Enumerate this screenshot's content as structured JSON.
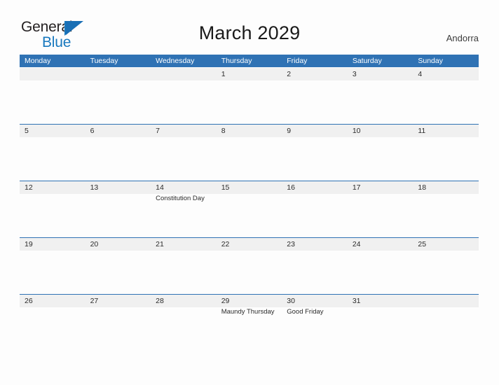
{
  "brand": {
    "name_part1": "General",
    "name_part2": "Blue",
    "flag_icon": "blue-triangle-flag",
    "accent_color": "#1878be"
  },
  "header": {
    "title": "March 2029",
    "country": "Andorra"
  },
  "calendar": {
    "header_color": "#2f72b4",
    "band_color": "#f0f0f0",
    "weekdays": [
      "Monday",
      "Tuesday",
      "Wednesday",
      "Thursday",
      "Friday",
      "Saturday",
      "Sunday"
    ],
    "weeks": [
      {
        "days": [
          {
            "number": "",
            "events": []
          },
          {
            "number": "",
            "events": []
          },
          {
            "number": "",
            "events": []
          },
          {
            "number": "1",
            "events": []
          },
          {
            "number": "2",
            "events": []
          },
          {
            "number": "3",
            "events": []
          },
          {
            "number": "4",
            "events": []
          }
        ]
      },
      {
        "days": [
          {
            "number": "5",
            "events": []
          },
          {
            "number": "6",
            "events": []
          },
          {
            "number": "7",
            "events": []
          },
          {
            "number": "8",
            "events": []
          },
          {
            "number": "9",
            "events": []
          },
          {
            "number": "10",
            "events": []
          },
          {
            "number": "11",
            "events": []
          }
        ]
      },
      {
        "days": [
          {
            "number": "12",
            "events": []
          },
          {
            "number": "13",
            "events": []
          },
          {
            "number": "14",
            "events": [
              "Constitution Day"
            ]
          },
          {
            "number": "15",
            "events": []
          },
          {
            "number": "16",
            "events": []
          },
          {
            "number": "17",
            "events": []
          },
          {
            "number": "18",
            "events": []
          }
        ]
      },
      {
        "days": [
          {
            "number": "19",
            "events": []
          },
          {
            "number": "20",
            "events": []
          },
          {
            "number": "21",
            "events": []
          },
          {
            "number": "22",
            "events": []
          },
          {
            "number": "23",
            "events": []
          },
          {
            "number": "24",
            "events": []
          },
          {
            "number": "25",
            "events": []
          }
        ]
      },
      {
        "days": [
          {
            "number": "26",
            "events": []
          },
          {
            "number": "27",
            "events": []
          },
          {
            "number": "28",
            "events": []
          },
          {
            "number": "29",
            "events": [
              "Maundy Thursday"
            ]
          },
          {
            "number": "30",
            "events": [
              "Good Friday"
            ]
          },
          {
            "number": "31",
            "events": []
          },
          {
            "number": "",
            "events": []
          }
        ]
      }
    ]
  }
}
